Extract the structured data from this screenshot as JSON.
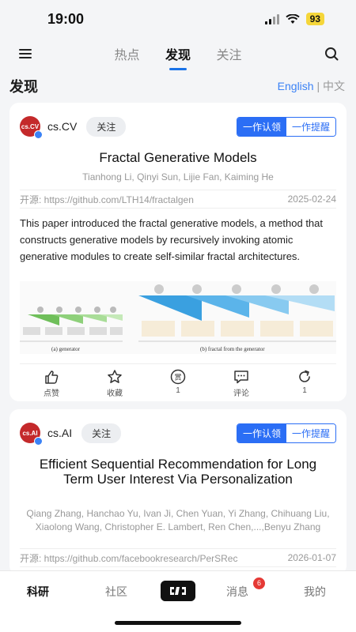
{
  "status": {
    "time": "19:00",
    "battery": "93"
  },
  "nav": {
    "tabs": [
      "热点",
      "发现",
      "关注"
    ],
    "active_index": 1
  },
  "section": {
    "title": "发现",
    "lang_en": "English",
    "lang_sep": "|",
    "lang_zh": "中文"
  },
  "cards": [
    {
      "source_name": "cs.CV",
      "avatar_text": "cs.CV",
      "follow_label": "关注",
      "claim_label": "一作认领",
      "remind_label": "一作提醒",
      "title": "Fractal Generative Models",
      "authors": "Tianhong Li, Qinyi Sun, Lijie Fan, Kaiming He",
      "source_link": "开源: https://github.com/LTH14/fractalgen",
      "date": "2025-02-24",
      "abstract": "This paper introduced the fractal generative models, a method that constructs generative models by recursively invoking atomic generative modules to create self-similar fractal architectures.",
      "figure_caption_a": "(a) generator",
      "figure_caption_b": "(b) fractal from the generator",
      "actions": [
        {
          "icon": "thumbs-up-icon",
          "label": "点赞"
        },
        {
          "icon": "star-icon",
          "label": "收藏"
        },
        {
          "icon": "reward-icon",
          "label": "1",
          "icon_text": "赏"
        },
        {
          "icon": "comment-icon",
          "label": "评论"
        },
        {
          "icon": "share-icon",
          "label": "1"
        }
      ]
    },
    {
      "source_name": "cs.AI",
      "avatar_text": "cs.AI",
      "follow_label": "关注",
      "claim_label": "一作认领",
      "remind_label": "一作提醒",
      "title": "Efficient Sequential Recommendation for Long Term User Interest Via Personalization",
      "authors": "Qiang Zhang, Hanchao Yu, Ivan Ji, Chen Yuan, Yi Zhang, Chihuang Liu, Xiaolong Wang, Christopher E. Lambert, Ren Chen,...,Benyu Zhang",
      "source_link": "开源: https://github.com/facebookresearch/PerSRec",
      "date": "2026-01-07"
    }
  ],
  "bottom_nav": {
    "items": [
      "科研",
      "社区",
      "消息",
      "我的"
    ],
    "message_badge": "6"
  },
  "colors": {
    "accent": "#2b6ef5",
    "avatar": "#c4292b",
    "badge": "#e53935"
  }
}
